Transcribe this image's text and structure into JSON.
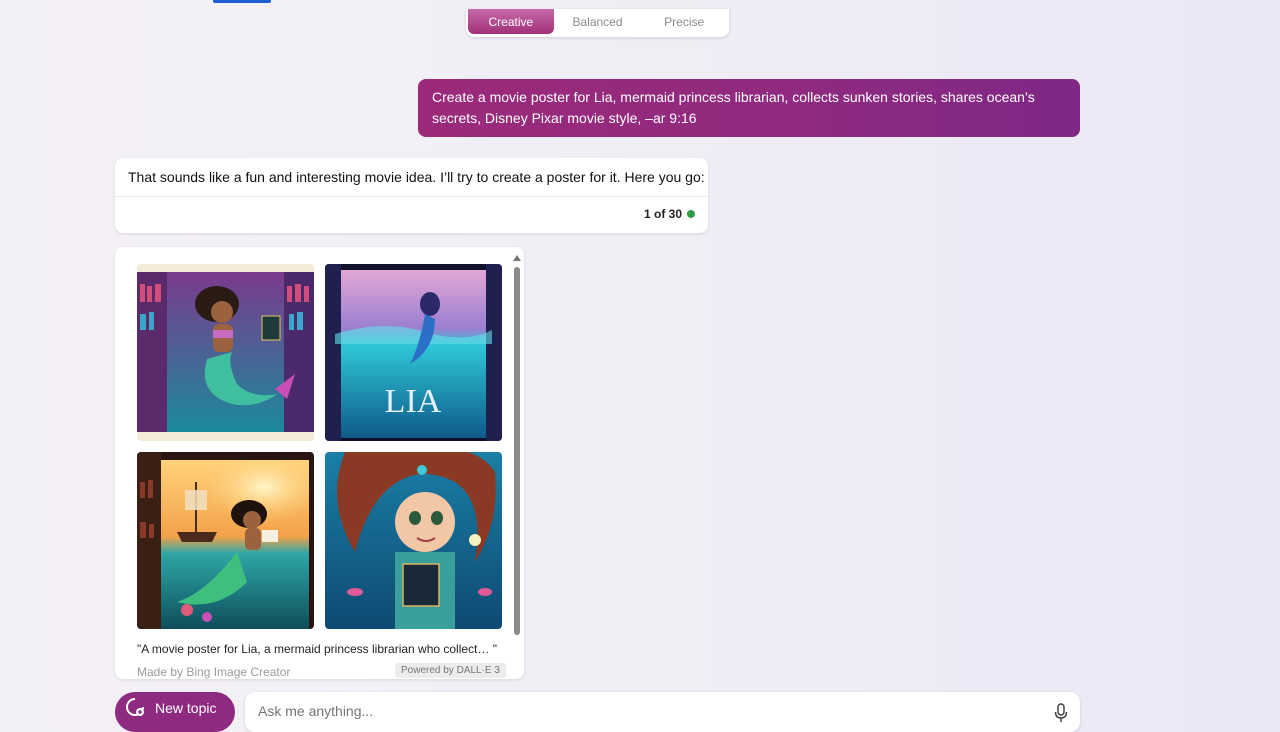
{
  "tone_switch": {
    "options": [
      "Creative",
      "Balanced",
      "Precise"
    ],
    "selected": "Creative"
  },
  "conversation": {
    "user_message": "Create a movie poster for Lia, mermaid princess librarian, collects sunken stories, shares ocean’s secrets, Disney Pixar movie style, –ar 9:16",
    "bot_message": "That sounds like a fun and interesting movie idea. I’ll try to create a poster for it. Here you go:",
    "turn_counter": "1 of 30",
    "image_result": {
      "caption": "\"A movie poster for Lia, a mermaid princess librarian who collect… \"",
      "made_by": "Made by Bing Image Creator",
      "powered_by": "Powered by DALL·E 3",
      "poster_title": "LIA",
      "images": [
        {
          "icon": "mermaid-library-image"
        },
        {
          "icon": "mermaid-poster-lia-image"
        },
        {
          "icon": "mermaid-shipwreck-image"
        },
        {
          "icon": "mermaid-with-book-image"
        }
      ]
    }
  },
  "composer": {
    "new_topic_label": "New topic",
    "placeholder": "Ask me anything..."
  },
  "colors": {
    "accent": "#8e2a80",
    "status_dot": "#2f9e44",
    "tab_indicator": "#1b5fd1"
  }
}
